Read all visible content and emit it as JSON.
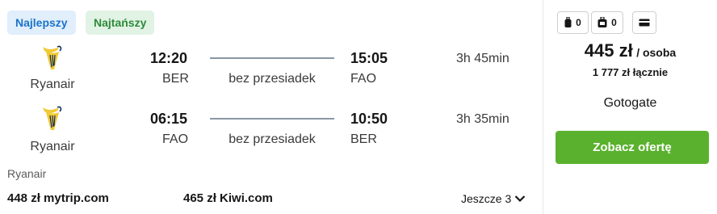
{
  "badges": {
    "best": "Najlepszy",
    "cheapest": "Najtańszy"
  },
  "legs": [
    {
      "airline": "Ryanair",
      "depart_time": "12:20",
      "depart_code": "BER",
      "stops": "bez przesiadek",
      "arrive_time": "15:05",
      "arrive_code": "FAO",
      "duration": "3h 45min"
    },
    {
      "airline": "Ryanair",
      "depart_time": "06:15",
      "depart_code": "FAO",
      "stops": "bez przesiadek",
      "arrive_time": "10:50",
      "arrive_code": "BER",
      "duration": "3h 35min"
    }
  ],
  "operator": "Ryanair",
  "alternatives": [
    {
      "label": "448 zł mytrip.com"
    },
    {
      "label": "465 zł Kiwi.com"
    }
  ],
  "more_label": "Jeszcze 3",
  "baggage": {
    "personal_count": "0",
    "cabin_count": "0"
  },
  "price": {
    "amount": "445 zł",
    "per": "/ osoba",
    "total": "1 777 zł łącznie"
  },
  "provider": "Gotogate",
  "cta_label": "Zobacz ofertę",
  "colors": {
    "cta": "#5ab12d",
    "best_badge_text": "#1b73c9",
    "cheap_badge_text": "#2e8b3b",
    "ryanair_logo": "#f1c933"
  }
}
